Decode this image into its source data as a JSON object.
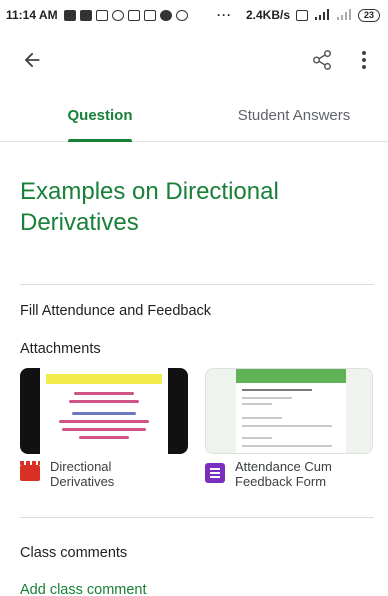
{
  "status_bar": {
    "time": "11:14 AM",
    "dots": "···",
    "network_speed": "2.4KB/s",
    "battery": "23"
  },
  "app_bar": {
    "back_icon": "arrow-back-icon",
    "share_icon": "share-icon",
    "more_icon": "more-vert-icon"
  },
  "tabs": [
    {
      "label": "Question",
      "active": true
    },
    {
      "label": "Student Answers",
      "active": false
    }
  ],
  "question": {
    "title": "Examples on Directional Derivatives",
    "description": "Fill Attendunce and Feedback"
  },
  "attachments": {
    "heading": "Attachments",
    "items": [
      {
        "type": "video",
        "icon": "youtube-video-icon",
        "name_line1": "Directional",
        "name_line2": "Derivatives"
      },
      {
        "type": "form",
        "icon": "google-forms-icon",
        "name_line1": "Attendance Cum",
        "name_line2": "Feedback Form"
      }
    ]
  },
  "comments": {
    "heading": "Class comments",
    "add_label": "Add class comment"
  },
  "colors": {
    "accent": "#188038",
    "video_icon": "#d93025",
    "forms_icon": "#7b2fbe"
  }
}
